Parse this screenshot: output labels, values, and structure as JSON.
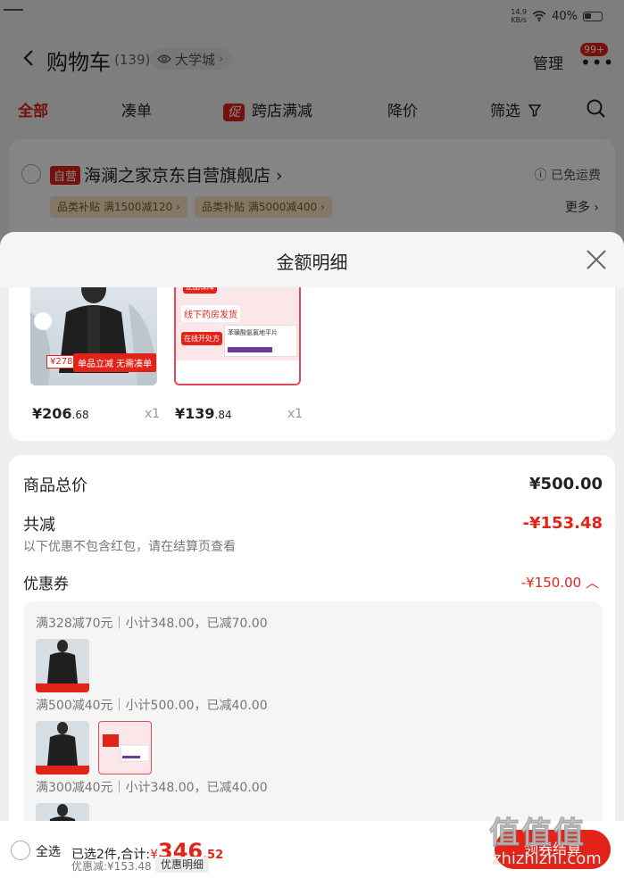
{
  "status_bar": {
    "net_speed": "14.9\nKB/s",
    "battery_pct": "40%"
  },
  "header": {
    "title": "购物车",
    "count": "(139)",
    "campus_label": "大学城",
    "manage_label": "管理",
    "more_badge": "99+"
  },
  "tabs": [
    {
      "label": "全部",
      "active": true
    },
    {
      "label": "凑单"
    },
    {
      "label": "跨店满减",
      "promo_tag": "促"
    },
    {
      "label": "降价"
    },
    {
      "label": "筛选"
    }
  ],
  "store": {
    "self_tag": "自营",
    "name": "海澜之家京东自营旗舰店",
    "free_shipping": "已免运费",
    "subsidies": [
      "品类补贴 满1500减120",
      "品类补贴 满5000减400"
    ],
    "more_label": "更多"
  },
  "sheet": {
    "title": "金额明细",
    "products": [
      {
        "price_int": "¥206",
        "price_dec": ".68",
        "qty": "x1",
        "img_label": "单品立减 无需凑单",
        "img_price": "¥278"
      },
      {
        "price_int": "¥139",
        "price_dec": ".84",
        "qty": "x1",
        "img_label": "线下药房发货",
        "img_sub": "在线开处方",
        "img_tag": "正品保障",
        "img_card": "苯磺酸氨氯地平片"
      }
    ],
    "summary": {
      "total_label": "商品总价",
      "total_value": "¥500.00",
      "discount_label": "共减",
      "discount_value": "-¥153.48",
      "note": "以下优惠不包含红包，请在结算页查看",
      "coupon_label": "优惠券",
      "coupon_value": "-¥150.00"
    },
    "coupon_lines": [
      "满328减70元｜小计348.00，已减70.00",
      "满500减40元｜小计500.00，已减40.00",
      "满300减40元｜小计348.00，已减40.00"
    ]
  },
  "bottom_bar": {
    "select_all": "全选",
    "selected_text": "已选2件,合计:",
    "total_yuan": "¥",
    "total_int": "346",
    "total_dec": ".52",
    "discount_text": "优惠减:¥153.48",
    "detail_label": "优惠明细",
    "checkout_label": "领券结算"
  },
  "watermark": {
    "big": "值值值",
    "small": "zhizhizhi.com"
  },
  "colors": {
    "accent": "#e2231a",
    "subsidy_bg": "#fbe6c7"
  }
}
